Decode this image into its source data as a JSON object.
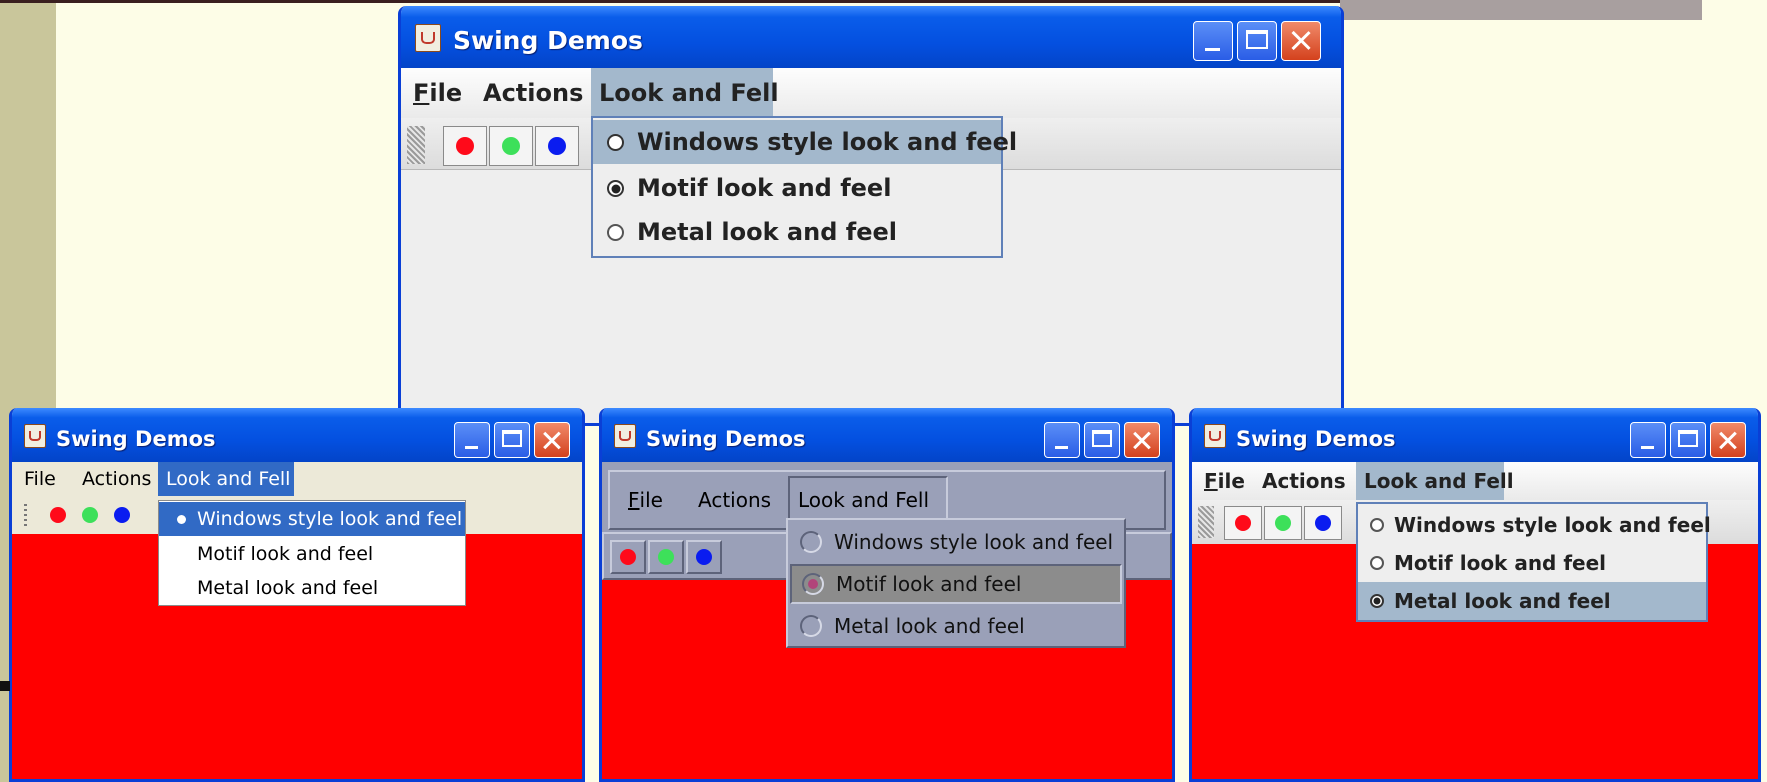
{
  "title": "Swing Demos",
  "menus": {
    "file": "File",
    "file_mnemonic": "F",
    "file_rest": "ile",
    "actions": "Actions",
    "laf": "Look and Fell"
  },
  "laf_options": [
    "Windows style look and feel",
    "Motif look and feel",
    "Metal look and feel"
  ],
  "toolbar_icons": [
    "red-circle-icon",
    "green-circle-icon",
    "blue-circle-icon"
  ],
  "colors": {
    "titlebar": "#0450e0",
    "content_red": "#ff0000",
    "dot_red": "#ff0a1a",
    "dot_green": "#3de05a",
    "dot_blue": "#0a1cf0",
    "windows_highlight": "#316ac5",
    "metal_highlight": "#a3b8cc",
    "motif_bg": "#9aa0b8"
  },
  "windows": {
    "top": {
      "selected": 1,
      "highlighted": 0
    },
    "win_laf": {
      "selected": 0,
      "highlighted": 0
    },
    "motif_laf": {
      "selected": 1,
      "highlighted": 1
    },
    "metal_laf": {
      "selected": 2,
      "highlighted": 2
    }
  }
}
